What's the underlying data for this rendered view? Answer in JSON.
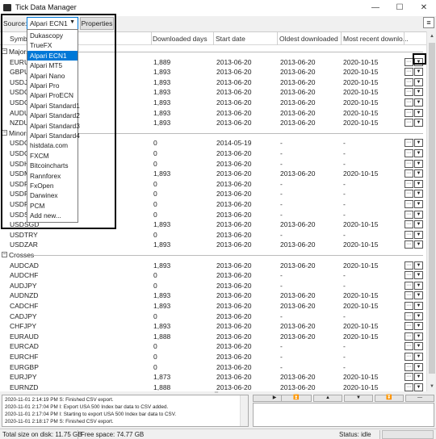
{
  "window": {
    "title": "Tick Data Manager"
  },
  "toolbar": {
    "source_label": "Source:",
    "source_value": "Alpari ECN1",
    "properties_label": "Properties",
    "menu_icon": "≡"
  },
  "columns": [
    "Symbol",
    "Downloaded days",
    "Start date",
    "Oldest downloaded",
    "Most recent downlo..."
  ],
  "groups": [
    {
      "name": "Majors",
      "rows": [
        {
          "sym": "EURUSD",
          "days": "1,889",
          "start": "2013-06-20",
          "oldest": "2013-06-20",
          "recent": "2020-10-15"
        },
        {
          "sym": "GBPUSD",
          "days": "1,893",
          "start": "2013-06-20",
          "oldest": "2013-06-20",
          "recent": "2020-10-15"
        },
        {
          "sym": "USDJPY",
          "days": "1,893",
          "start": "2013-06-20",
          "oldest": "2013-06-20",
          "recent": "2020-10-15"
        },
        {
          "sym": "USDCHF",
          "days": "1,893",
          "start": "2013-06-20",
          "oldest": "2013-06-20",
          "recent": "2020-10-15"
        },
        {
          "sym": "USDCAD",
          "days": "1,893",
          "start": "2013-06-20",
          "oldest": "2013-06-20",
          "recent": "2020-10-15"
        },
        {
          "sym": "AUDUSD",
          "days": "1,893",
          "start": "2013-06-20",
          "oldest": "2013-06-20",
          "recent": "2020-10-15"
        },
        {
          "sym": "NZDUSD",
          "days": "1,893",
          "start": "2013-06-20",
          "oldest": "2013-06-20",
          "recent": "2020-10-15"
        }
      ]
    },
    {
      "name": "Minors",
      "rows": [
        {
          "sym": "USDCNH",
          "days": "0",
          "start": "2014-05-19",
          "oldest": "-",
          "recent": "-"
        },
        {
          "sym": "USDCZK",
          "days": "0",
          "start": "2013-06-20",
          "oldest": "-",
          "recent": "-"
        },
        {
          "sym": "USDHKD",
          "days": "0",
          "start": "2013-06-20",
          "oldest": "-",
          "recent": "-"
        },
        {
          "sym": "USDMXN",
          "days": "1,893",
          "start": "2013-06-20",
          "oldest": "2013-06-20",
          "recent": "2020-10-15"
        },
        {
          "sym": "USDPLN",
          "days": "0",
          "start": "2013-06-20",
          "oldest": "-",
          "recent": "-"
        },
        {
          "sym": "USDRUB",
          "days": "0",
          "start": "2013-06-20",
          "oldest": "-",
          "recent": "-"
        },
        {
          "sym": "USDRON",
          "days": "0",
          "start": "2013-06-20",
          "oldest": "-",
          "recent": "-"
        },
        {
          "sym": "USDSEK",
          "days": "0",
          "start": "2013-06-20",
          "oldest": "-",
          "recent": "-"
        },
        {
          "sym": "USDSGD",
          "days": "1,893",
          "start": "2013-06-20",
          "oldest": "2013-06-20",
          "recent": "2020-10-15"
        },
        {
          "sym": "USDTRY",
          "days": "0",
          "start": "2013-06-20",
          "oldest": "-",
          "recent": "-"
        },
        {
          "sym": "USDZAR",
          "days": "1,893",
          "start": "2013-06-20",
          "oldest": "2013-06-20",
          "recent": "2020-10-15"
        }
      ]
    },
    {
      "name": "Crosses",
      "rows": [
        {
          "sym": "AUDCAD",
          "days": "1,893",
          "start": "2013-06-20",
          "oldest": "2013-06-20",
          "recent": "2020-10-15"
        },
        {
          "sym": "AUDCHF",
          "days": "0",
          "start": "2013-06-20",
          "oldest": "-",
          "recent": "-"
        },
        {
          "sym": "AUDJPY",
          "days": "0",
          "start": "2013-06-20",
          "oldest": "-",
          "recent": "-"
        },
        {
          "sym": "AUDNZD",
          "days": "1,893",
          "start": "2013-06-20",
          "oldest": "2013-06-20",
          "recent": "2020-10-15"
        },
        {
          "sym": "CADCHF",
          "days": "1,893",
          "start": "2013-06-20",
          "oldest": "2013-06-20",
          "recent": "2020-10-15"
        },
        {
          "sym": "CADJPY",
          "days": "0",
          "start": "2013-06-20",
          "oldest": "-",
          "recent": "-"
        },
        {
          "sym": "CHFJPY",
          "days": "1,893",
          "start": "2013-06-20",
          "oldest": "2013-06-20",
          "recent": "2020-10-15"
        },
        {
          "sym": "EURAUD",
          "days": "1,888",
          "start": "2013-06-20",
          "oldest": "2013-06-20",
          "recent": "2020-10-15"
        },
        {
          "sym": "EURCAD",
          "days": "0",
          "start": "2013-06-20",
          "oldest": "-",
          "recent": "-"
        },
        {
          "sym": "EURCHF",
          "days": "0",
          "start": "2013-06-20",
          "oldest": "-",
          "recent": "-"
        },
        {
          "sym": "EURGBP",
          "days": "0",
          "start": "2013-06-20",
          "oldest": "-",
          "recent": "-"
        },
        {
          "sym": "EURJPY",
          "days": "1,873",
          "start": "2013-06-20",
          "oldest": "2013-06-20",
          "recent": "2020-10-15"
        },
        {
          "sym": "EURNZD",
          "days": "1,888",
          "start": "2013-06-20",
          "oldest": "2013-06-20",
          "recent": "2020-10-15"
        }
      ]
    }
  ],
  "dropdown_options": [
    "Dukascopy",
    "TrueFX",
    "Alpari ECN1",
    "Alpari MT5",
    "Alpari Nano",
    "Alpari Pro",
    "Alpari ProECN",
    "Alpari Standard1",
    "Alpari Standard2",
    "Alpari Standard3",
    "Alpari Standard4",
    "histdata.com",
    "FXCM",
    "Bitcoincharts",
    "Rannforex",
    "FxOpen",
    "Darwinex",
    "PCM",
    "Add new..."
  ],
  "dropdown_selected": "Alpari ECN1",
  "log": [
    "2020-11-01 2:14:19 PM  S: Finished CSV export.",
    "2020-11-01 2:17:04 PM  I: Export USA 500 Index bar data to CSV added.",
    "2020-11-01 2:17:04 PM  I: Starting to export USA 500 Index bar data to CSV.",
    "2020-11-01 2:18:17 PM  S: Finished CSV export."
  ],
  "status": {
    "disk": "Total size on disk: 11.75 GB",
    "free": "Free space: 74.77 GB",
    "state": "Status: idle"
  },
  "colors": {
    "accent": "#0078d7"
  }
}
